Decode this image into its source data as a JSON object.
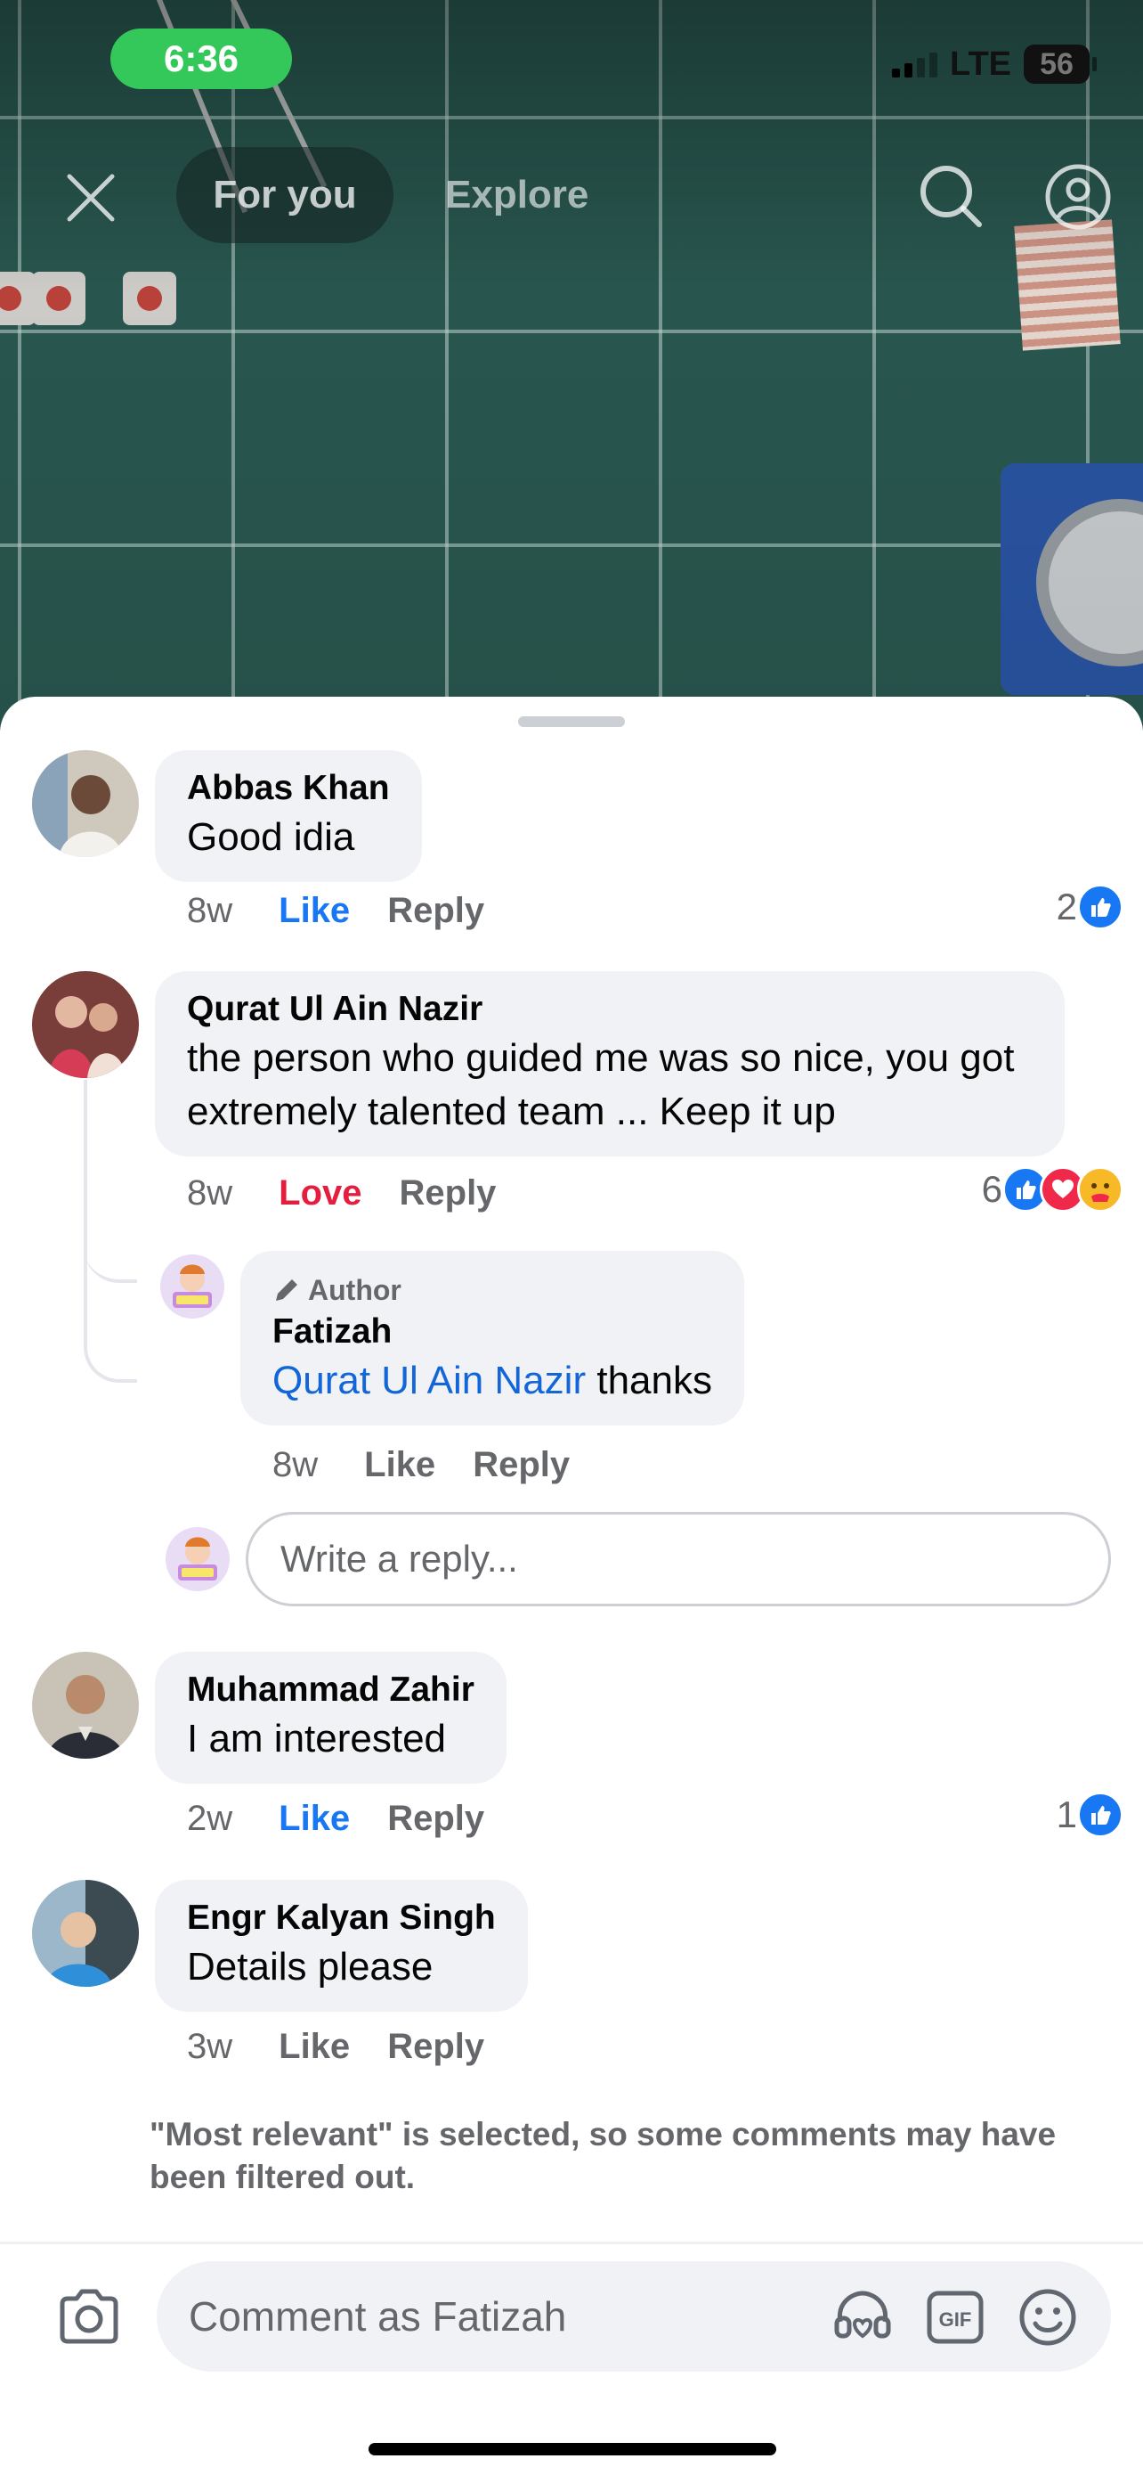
{
  "status_bar": {
    "time": "6:36",
    "network": "LTE",
    "battery": "56"
  },
  "top_nav": {
    "tabs": [
      {
        "label": "For you",
        "active": true
      },
      {
        "label": "Explore",
        "active": false
      }
    ],
    "icons": [
      "close-icon",
      "search-icon",
      "profile-icon"
    ]
  },
  "comments": [
    {
      "author": "Abbas Khan",
      "text": "Good idia",
      "age": "8w",
      "like": "Like",
      "reply": "Reply",
      "reaction_count": "2",
      "my_reaction": "like"
    },
    {
      "author": "Qurat Ul Ain Nazir",
      "text": "the person who guided me was so nice, you got extremely talented team ... Keep it up",
      "age": "8w",
      "like": "Love",
      "reply": "Reply",
      "reaction_count": "6",
      "my_reaction": "love"
    },
    {
      "author": "Muhammad Zahir",
      "text": "I am interested",
      "age": "2w",
      "like": "Like",
      "reply": "Reply",
      "reaction_count": "1",
      "my_reaction": "like"
    },
    {
      "author": "Engr Kalyan Singh",
      "text": "Details please",
      "age": "3w",
      "like": "Like",
      "reply": "Reply"
    }
  ],
  "reply": {
    "badge": "Author",
    "author": "Fatizah",
    "mention": "Qurat Ul Ain Nazir",
    "text": "thanks",
    "age": "8w",
    "like": "Like",
    "reply": "Reply"
  },
  "reply_input": {
    "placeholder": "Write a reply..."
  },
  "filter_note": "\"Most relevant\" is selected, so some comments may have been filtered out.",
  "composer": {
    "placeholder": "Comment as Fatizah",
    "icons": [
      "camera-icon",
      "avatar-sticker-icon",
      "gif-icon",
      "emoji-icon"
    ]
  },
  "colors": {
    "link": "#1266d8",
    "like_blue": "#1877f2",
    "love_red": "#e41e3f",
    "status_green": "#34c759"
  }
}
